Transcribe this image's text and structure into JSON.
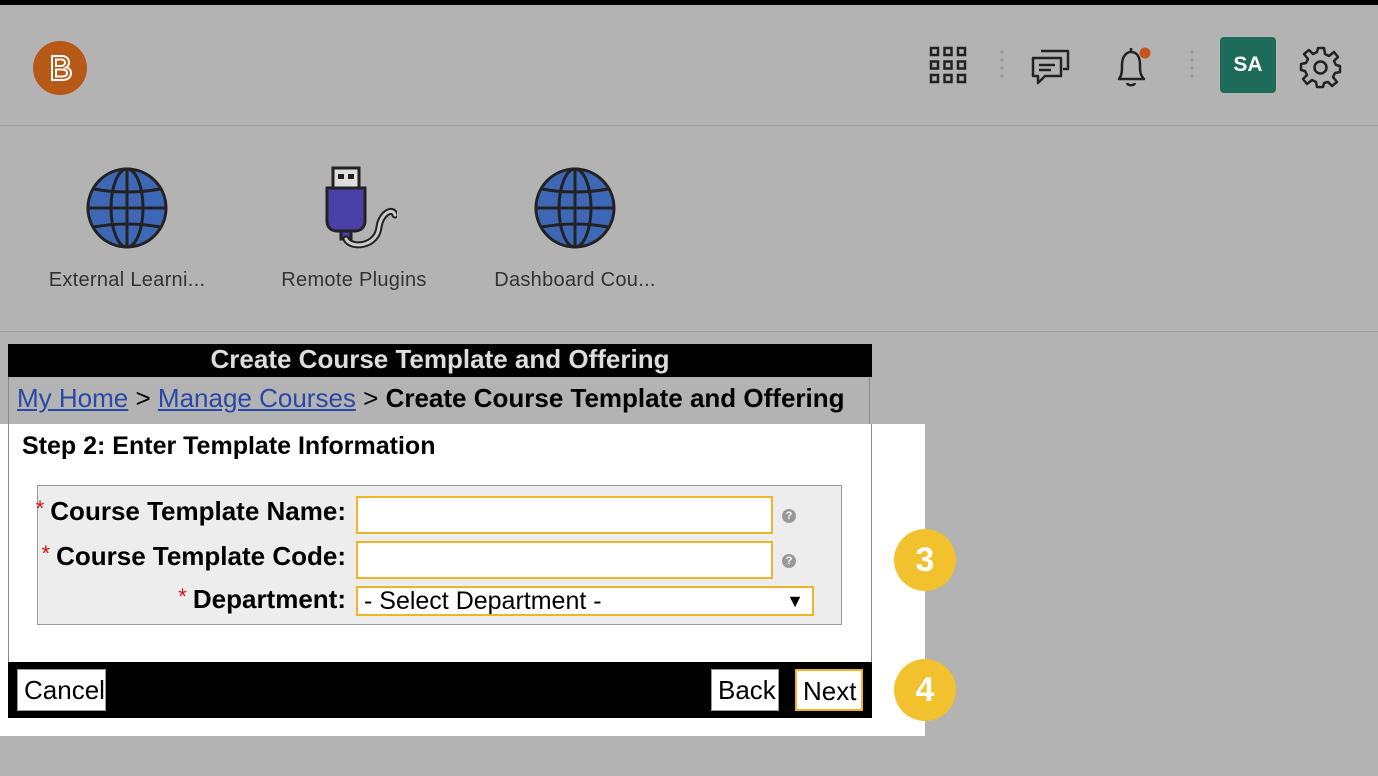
{
  "header": {
    "logo_letter": "B",
    "avatar_initials": "SA",
    "icons": [
      "apps-grid-icon",
      "chat-icon",
      "bell-icon",
      "gear-icon"
    ],
    "notification_color": "#c8531a"
  },
  "tiles": [
    {
      "label": "External Learni...",
      "icon": "globe-icon"
    },
    {
      "label": "Remote Plugins",
      "icon": "usb-plug-icon"
    },
    {
      "label": "Dashboard Cou...",
      "icon": "globe-icon"
    }
  ],
  "page": {
    "title": "Create Course Template and Offering",
    "breadcrumb": {
      "home": "My Home",
      "sep1": ">",
      "manage": "Manage Courses",
      "sep2": ">",
      "current": "Create Course Template and Offering"
    },
    "step_title": "Step 2: Enter Template Information"
  },
  "form": {
    "required_mark": "*",
    "template_name_label": "Course Template Name:",
    "template_name_value": "",
    "template_code_label": "Course Template Code:",
    "template_code_value": "",
    "department_label": "Department:",
    "department_selected": "- Select Department -",
    "help_glyph": "?"
  },
  "buttons": {
    "cancel": "Cancel",
    "back": "Back",
    "next": "Next"
  },
  "callouts": {
    "form_step": "3",
    "next_step": "4"
  },
  "colors": {
    "accent": "#f0b429",
    "callout": "#f2c12e",
    "avatar_bg": "#1f6b5a",
    "logo_bg": "#b85a17",
    "link": "#2a48a6"
  }
}
